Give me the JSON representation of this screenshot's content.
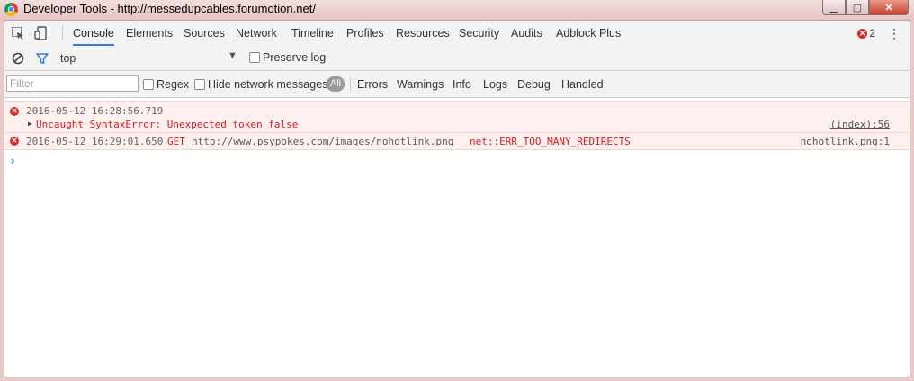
{
  "window": {
    "title": "Developer Tools - http://messedupcables.forumotion.net/"
  },
  "tabs": [
    "Console",
    "Elements",
    "Sources",
    "Network",
    "Timeline",
    "Profiles",
    "Resources",
    "Security",
    "Audits",
    "Adblock Plus"
  ],
  "active_tab": "Console",
  "error_count": "2",
  "toolbar": {
    "context": "top",
    "preserve_log": "Preserve log"
  },
  "filterbar": {
    "placeholder": "Filter",
    "regex": "Regex",
    "hide_network": "Hide network messages",
    "all": "All",
    "levels": [
      "Errors",
      "Warnings",
      "Info",
      "Logs",
      "Debug",
      "Handled"
    ]
  },
  "messages": [
    {
      "timestamp": "2016-05-12 16:28:56.719",
      "text": "Uncaught SyntaxError: Unexpected token false",
      "source": "(index):56"
    },
    {
      "timestamp": "2016-05-12 16:29:01.650",
      "method": "GET",
      "url": "http://www.psypokes.com/images/nohotlink.png",
      "error": "net::ERR_TOO_MANY_REDIRECTS",
      "source": "nohotlink.png:1"
    }
  ],
  "colors": {
    "accent": "#3879d9",
    "error": "#d92b2b",
    "error_bg": "#fff0f0"
  }
}
